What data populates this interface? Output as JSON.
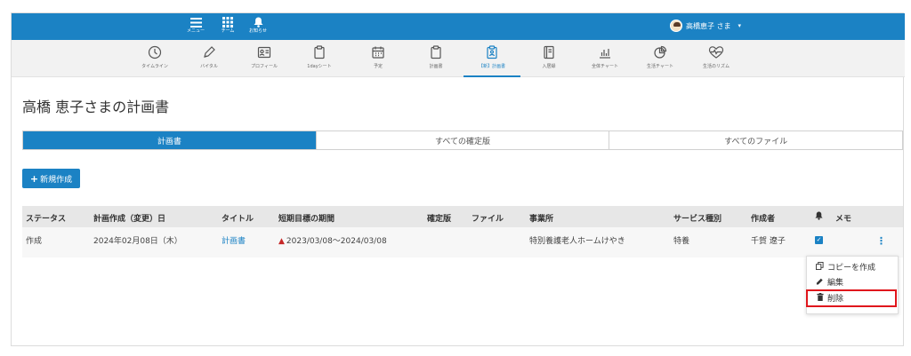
{
  "topbar": {
    "menu_label": "メニュー",
    "team_label": "チーム",
    "notice_label": "お知らせ",
    "user_name": "高橋恵子 さま",
    "caret": "▾"
  },
  "tabs": [
    {
      "label": "タイムライン",
      "icon": "clock-icon"
    },
    {
      "label": "バイタル",
      "icon": "pen-icon"
    },
    {
      "label": "プロフィール",
      "icon": "profile-card-icon"
    },
    {
      "label": "1dayシート",
      "icon": "clipboard-icon"
    },
    {
      "label": "予定",
      "icon": "calendar-icon"
    },
    {
      "label": "計画書",
      "icon": "clipboard-icon"
    },
    {
      "label": "【新】計画書",
      "icon": "clipboard-person-icon"
    },
    {
      "label": "入居録",
      "icon": "book-icon"
    },
    {
      "label": "全体チャート",
      "icon": "bar-chart-icon"
    },
    {
      "label": "生活チャート",
      "icon": "pie-chart-icon"
    },
    {
      "label": "生活のリズム",
      "icon": "heart-pulse-icon"
    }
  ],
  "page_title": "高橋 恵子さまの計画書",
  "segments": [
    "計画書",
    "すべての確定版",
    "すべてのファイル"
  ],
  "new_button": {
    "plus": "+",
    "label": "新規作成"
  },
  "table": {
    "headers": [
      "ステータス",
      "計画作成（変更）日",
      "タイトル",
      "短期目標の期間",
      "確定版",
      "ファイル",
      "事業所",
      "サービス種別",
      "作成者",
      "メモ"
    ],
    "row": {
      "status": "作成",
      "date": "2024年02月08日（木）",
      "title": "計画書",
      "period": "2023/03/08～2024/03/08",
      "office": "特別養護老人ホームけやき",
      "service": "特養",
      "author": "千賀 遼子"
    }
  },
  "menu": {
    "copy": "コピーを作成",
    "edit": "編集",
    "delete": "削除"
  },
  "colors": {
    "primary": "#1b82c4",
    "highlight": "#e0161c"
  }
}
